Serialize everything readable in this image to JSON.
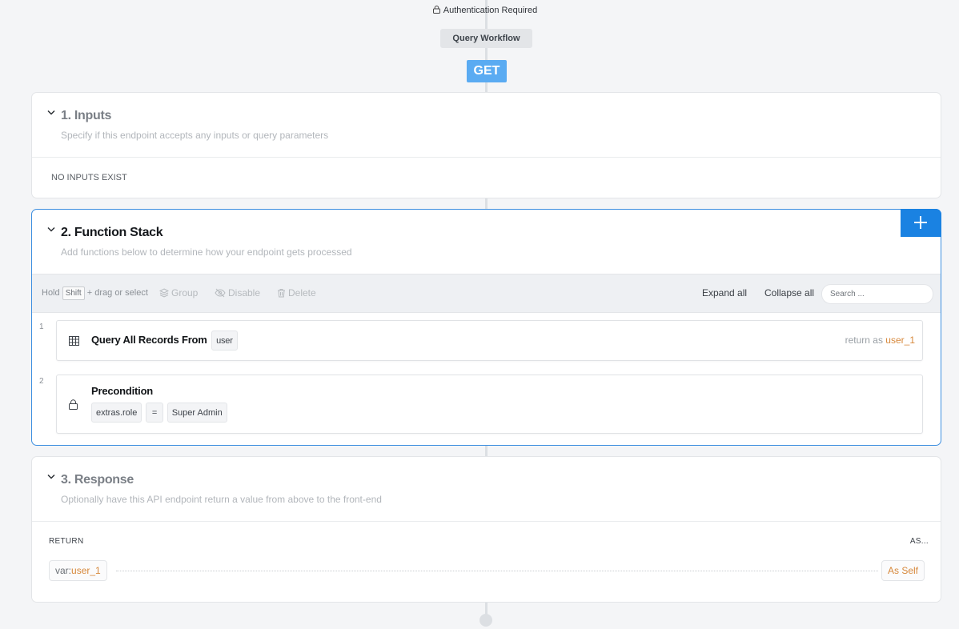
{
  "header": {
    "auth_label": "Authentication Required",
    "workflow_tag": "Query Workflow",
    "method": "GET"
  },
  "inputs_section": {
    "title": "1. Inputs",
    "subtitle": "Specify if this endpoint accepts any inputs or query parameters",
    "empty_text": "NO INPUTS EXIST"
  },
  "function_stack": {
    "title": "2. Function Stack",
    "subtitle": "Add functions below to determine how your endpoint gets processed",
    "add_icon": "plus-icon",
    "toolbar": {
      "hold": "Hold",
      "shift_key": "Shift",
      "drag_hint": "+ drag or select",
      "group": "Group",
      "disable": "Disable",
      "delete": "Delete",
      "expand_all": "Expand all",
      "collapse_all": "Collapse all",
      "search_placeholder": "Search ..."
    },
    "steps": [
      {
        "number": "1",
        "icon": "table-icon",
        "label": "Query All Records From",
        "table": "user",
        "return_prefix": "return as",
        "return_var": "user_1"
      },
      {
        "number": "2",
        "icon": "lock-icon",
        "label": "Precondition",
        "left": "extras.role",
        "operator": "=",
        "right": "Super Admin"
      }
    ]
  },
  "response_section": {
    "title": "3. Response",
    "subtitle": "Optionally have this API endpoint return a value from above to the front-end",
    "return_header": "RETURN",
    "as_header": "AS...",
    "var_prefix": "var:",
    "var_name": "user_1",
    "as_value": "As Self"
  },
  "colors": {
    "accent_blue": "#1a82e2",
    "get_badge": "#5aabf2",
    "orange": "#d7883b"
  }
}
